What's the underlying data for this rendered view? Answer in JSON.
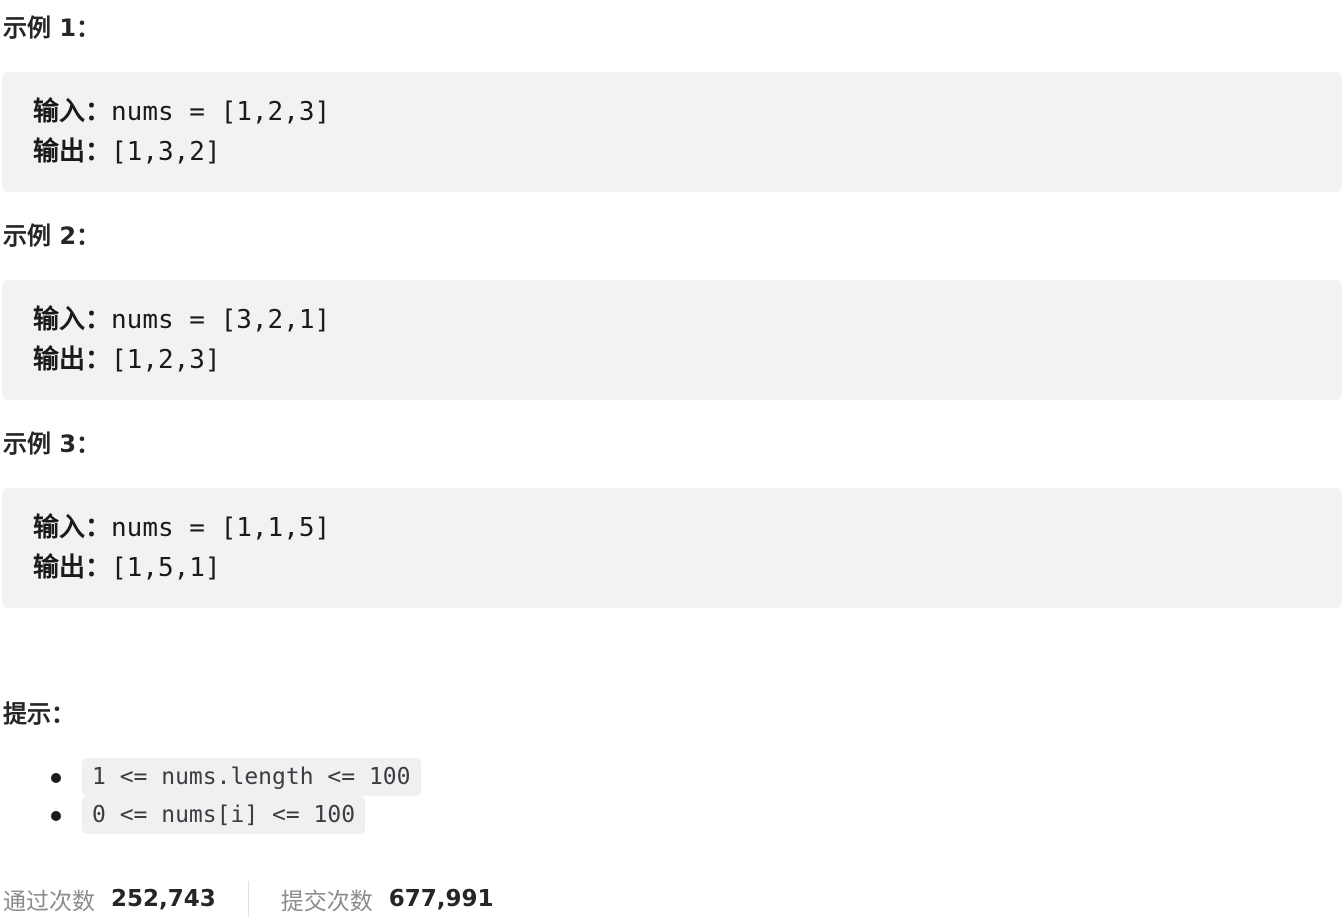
{
  "examples": [
    {
      "title": "示例 1：",
      "input_label": "输入：",
      "input_value": "nums = [1,2,3]",
      "output_label": "输出：",
      "output_value": "[1,3,2]"
    },
    {
      "title": "示例 2：",
      "input_label": "输入：",
      "input_value": "nums = [3,2,1]",
      "output_label": "输出：",
      "output_value": "[1,2,3]"
    },
    {
      "title": "示例 3：",
      "input_label": "输入：",
      "input_value": "nums = [1,1,5]",
      "output_label": "输出：",
      "output_value": "[1,5,1]"
    }
  ],
  "hints": {
    "title": "提示：",
    "items": [
      "1 <= nums.length <= 100",
      "0 <= nums[i] <= 100"
    ]
  },
  "stats": {
    "accepted_label": "通过次数",
    "accepted_value": "252,743",
    "submissions_label": "提交次数",
    "submissions_value": "677,991"
  }
}
